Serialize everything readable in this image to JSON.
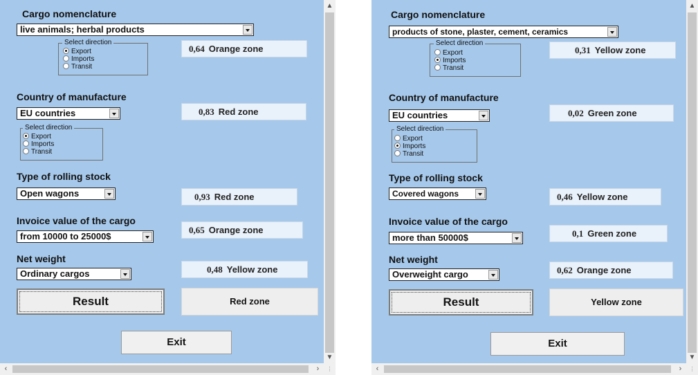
{
  "left": {
    "cargo": {
      "heading": "Cargo nomenclature",
      "selected": "live animals; herbal products",
      "direction_title": "Select direction",
      "options": [
        "Export",
        "Imports",
        "Transit"
      ],
      "checked": "Export",
      "zone_value": "0,64",
      "zone_label": "Orange zone"
    },
    "country": {
      "heading": "Country of manufacture",
      "selected": "EU countries",
      "direction_title": "Select direction",
      "options": [
        "Export",
        "Imports",
        "Transit"
      ],
      "checked": "Export",
      "zone_value": "0,83",
      "zone_label": "Red zone"
    },
    "rolling": {
      "heading": "Type of rolling stock",
      "selected": "Open wagons",
      "zone_value": "0,93",
      "zone_label": "Red zone"
    },
    "invoice": {
      "heading": "Invoice value of the cargo",
      "selected": "from 10000 to 25000$",
      "zone_value": "0,65",
      "zone_label": "Orange zone"
    },
    "weight": {
      "heading": "Net weight",
      "selected": "Ordinary cargos",
      "zone_value": "0,48",
      "zone_label": "Yellow zone"
    },
    "result_label": "Result",
    "result_zone": "Red zone",
    "exit_label": "Exit"
  },
  "right": {
    "cargo": {
      "heading": "Cargo nomenclature",
      "selected": "products of stone, plaster, cement, ceramics",
      "direction_title": "Select direction",
      "options": [
        "Export",
        "Imports",
        "Transit"
      ],
      "checked": "Imports",
      "zone_value": "0,31",
      "zone_label": "Yellow zone"
    },
    "country": {
      "heading": "Country of manufacture",
      "selected": "EU countries",
      "direction_title": "Select direction",
      "options": [
        "Export",
        "Imports",
        "Transit"
      ],
      "checked": "Imports",
      "zone_value": "0,02",
      "zone_label": "Green zone"
    },
    "rolling": {
      "heading": "Type of rolling stock",
      "selected": "Covered wagons",
      "zone_value": "0,46",
      "zone_label": "Yellow zone"
    },
    "invoice": {
      "heading": "Invoice value of the cargo",
      "selected": "more than 50000$",
      "zone_value": "0,1",
      "zone_label": "Green zone"
    },
    "weight": {
      "heading": "Net weight",
      "selected": "Overweight cargo",
      "zone_value": "0,62",
      "zone_label": "Orange zone"
    },
    "result_label": "Result",
    "result_zone": "Yellow zone",
    "exit_label": "Exit"
  },
  "scroll_icons": {
    "up": "chevron-up-icon",
    "down": "chevron-down-icon",
    "left": "chevron-left-icon",
    "right": "chevron-right-icon"
  },
  "colors": {
    "form_background": "#a6c8ea",
    "zone_box": "#e9f1fa",
    "button": "#eeeeee"
  }
}
